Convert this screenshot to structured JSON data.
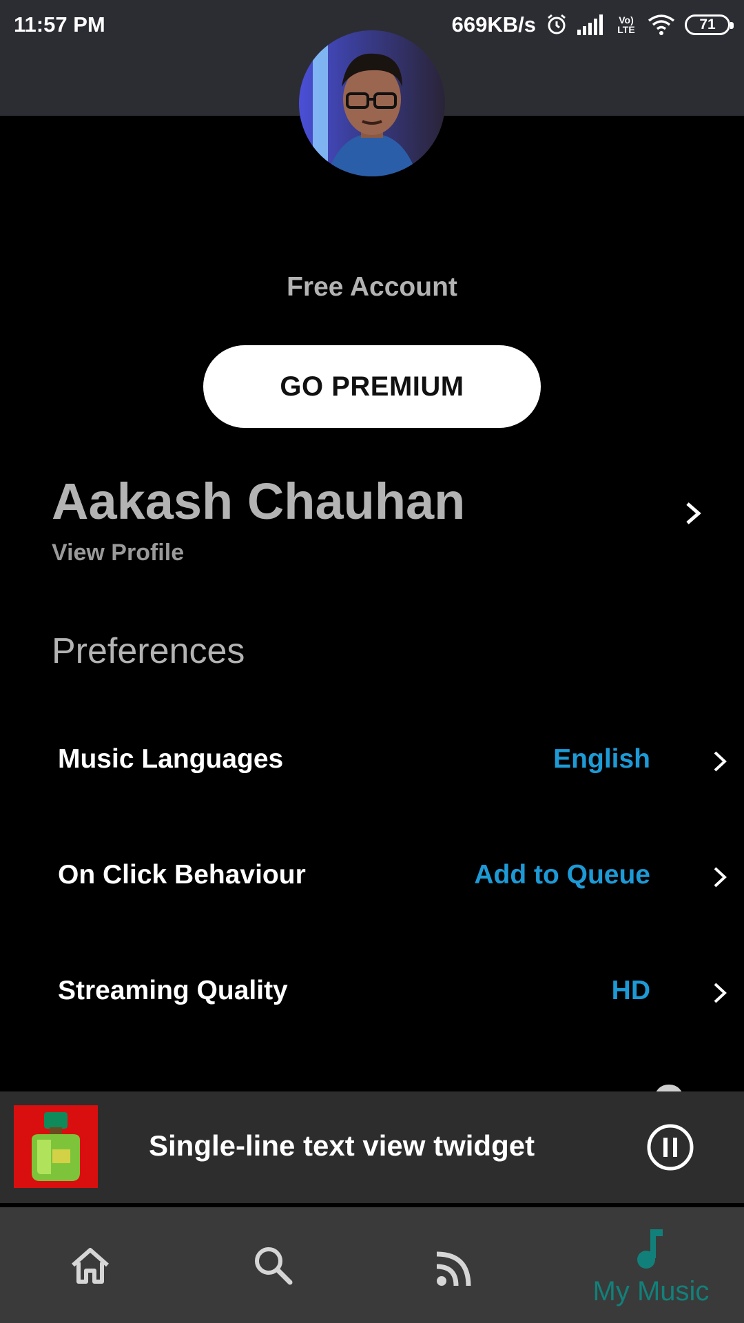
{
  "status_bar": {
    "time": "11:57 PM",
    "net_speed": "669KB/s",
    "network_type": "Vo) LTE",
    "battery": "71"
  },
  "account": {
    "type_label": "Free Account",
    "premium_button": "GO PREMIUM"
  },
  "profile": {
    "name": "Aakash Chauhan",
    "view_profile": "View Profile"
  },
  "preferences": {
    "title": "Preferences",
    "items": [
      {
        "label": "Music Languages",
        "value": "English"
      },
      {
        "label": "On Click Behaviour",
        "value": "Add to Queue"
      },
      {
        "label": "Streaming Quality",
        "value": "HD"
      }
    ]
  },
  "player": {
    "track_title": "Single-line text view twidget"
  },
  "nav": {
    "items": [
      {
        "icon": "home-icon"
      },
      {
        "icon": "search-icon"
      },
      {
        "icon": "rss-icon"
      },
      {
        "icon": "music-note-icon",
        "label": "My Music"
      }
    ]
  },
  "colors": {
    "header_bg": "#2c2d33",
    "accent_blue": "#1d9ad6",
    "accent_teal": "#12807a",
    "player_bg": "#2d2d2d",
    "nav_bg": "#3a3a3a"
  }
}
